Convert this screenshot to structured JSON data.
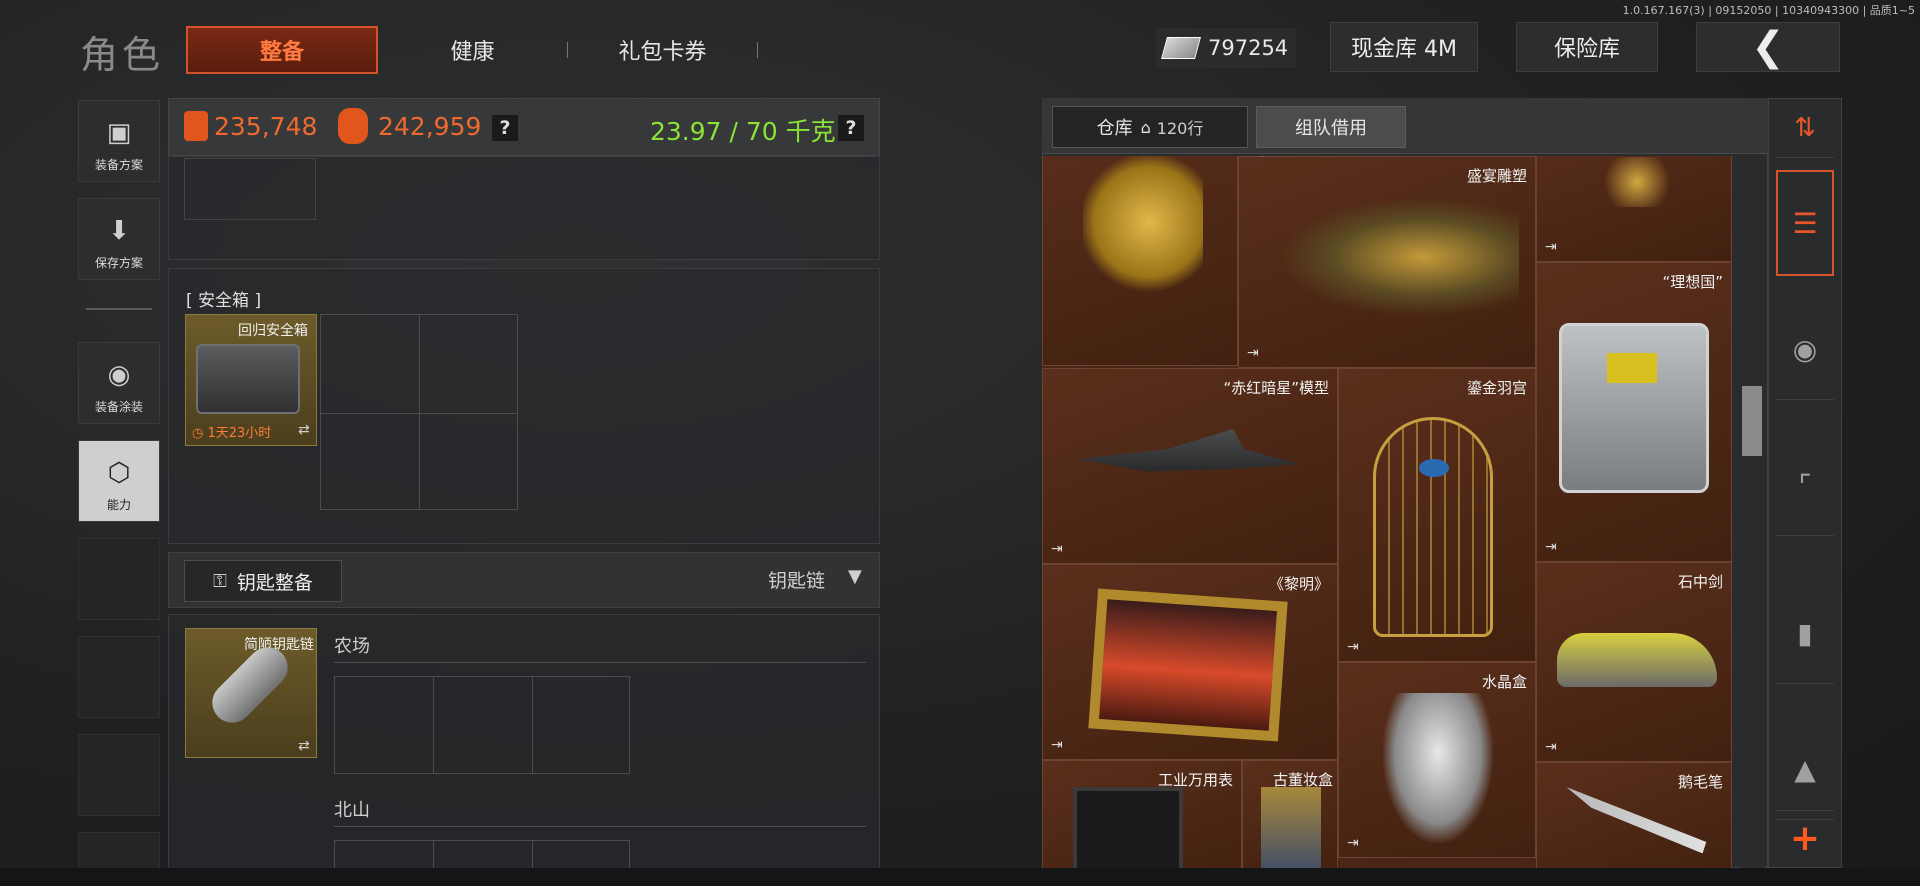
{
  "version": "1.0.167.167(3) | 09152050 | 10340943300 | 品质1~5",
  "header": {
    "title": "角色",
    "tabs": [
      {
        "label": "整备",
        "active": true
      },
      {
        "label": "健康"
      },
      {
        "label": "礼包卡券"
      }
    ],
    "money": "797254",
    "cash_button": "现金库 4M",
    "safe_button": "保险库",
    "back_icon": "chevron-left-icon"
  },
  "sidebar": [
    {
      "label": "装备方案",
      "icon": "vest-icon"
    },
    {
      "label": "保存方案",
      "icon": "download-icon"
    },
    {
      "label": "装备涂装",
      "icon": "helmet-icon"
    },
    {
      "label": "能力",
      "icon": "lightning-hex-icon",
      "active": true
    }
  ],
  "stats": {
    "value1": "235,748",
    "value2": "242,959",
    "help": "?",
    "weight": "23.97 / 70 千克",
    "accent": "#ef6a2e",
    "weight_color": "#8be336"
  },
  "safe": {
    "label": "[ 安全箱 ]",
    "item_name": "回归安全箱",
    "timer": "1天23小时",
    "swap_icon": "⇄"
  },
  "keys": {
    "button_label": "钥匙整备",
    "chain_label": "钥匙链",
    "item_name": "简陋钥匙链",
    "regions": [
      "农场",
      "北山"
    ]
  },
  "warehouse": {
    "tab_label": "仓库",
    "tab_count": "120行",
    "team_tab": "组队借用",
    "items": [
      {
        "name": "盛宴雕塑"
      },
      {
        "name": "“理想国”"
      },
      {
        "name": "“赤红暗星”模型"
      },
      {
        "name": "鎏金羽宫"
      },
      {
        "name": "《黎明》"
      },
      {
        "name": "石中剑"
      },
      {
        "name": "水晶盒"
      },
      {
        "name": "工业万用表"
      },
      {
        "name": "古董妆盒"
      },
      {
        "name": "鹅毛笔"
      }
    ],
    "exit_icon": "⇥"
  },
  "filters": [
    "sort-icon",
    "all-items-icon",
    "helmet-icon",
    "rifle-icon",
    "magazine-icon",
    "ammo-icon",
    "add-icon"
  ],
  "colors": {
    "accent": "#d4532a",
    "grid_bg": "#4a2616"
  }
}
